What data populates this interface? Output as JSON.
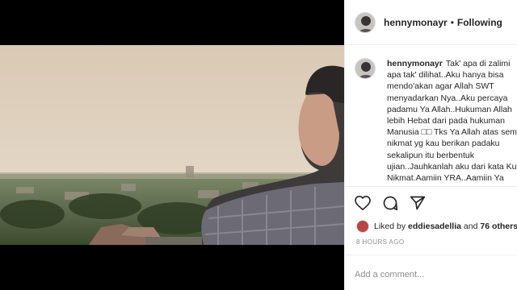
{
  "post": {
    "username": "hennymonayr",
    "separator": "•",
    "follow_status": "Following"
  },
  "caption": {
    "username": "hennymonayr",
    "lines": [
      "Tak' apa di zalimi",
      "apa tak' dilihat..Aku hanya bisa",
      "mendo'akan agar Allah SWT",
      "menyadarkan Nya..Aku percaya",
      "padamu Ya Allah..Hukuman Allah",
      "lebih Hebat dari pada hukuman",
      "Manusia □□ Tks Ya Allah atas sem",
      "nikmat yg kau berikan padaku",
      "sekalipun itu berbentuk",
      "ujian..Jauhkanlah aku dari kata Ku",
      "Nikmat.Aamiin YRA..Aamiin Ya"
    ]
  },
  "actions": {
    "icons": [
      "heart-icon",
      "comment-icon",
      "share-icon"
    ]
  },
  "likes": {
    "prefix": "Liked by",
    "user": "eddiesadellia",
    "conjunction": "and",
    "others": "76 others"
  },
  "timestamp": "8 HOURS AGO",
  "comment": {
    "placeholder": "Add a comment..."
  },
  "colors": {
    "text": "#262626",
    "muted": "#8e8e8e",
    "border": "#efefef",
    "media_bg": "#000000"
  }
}
